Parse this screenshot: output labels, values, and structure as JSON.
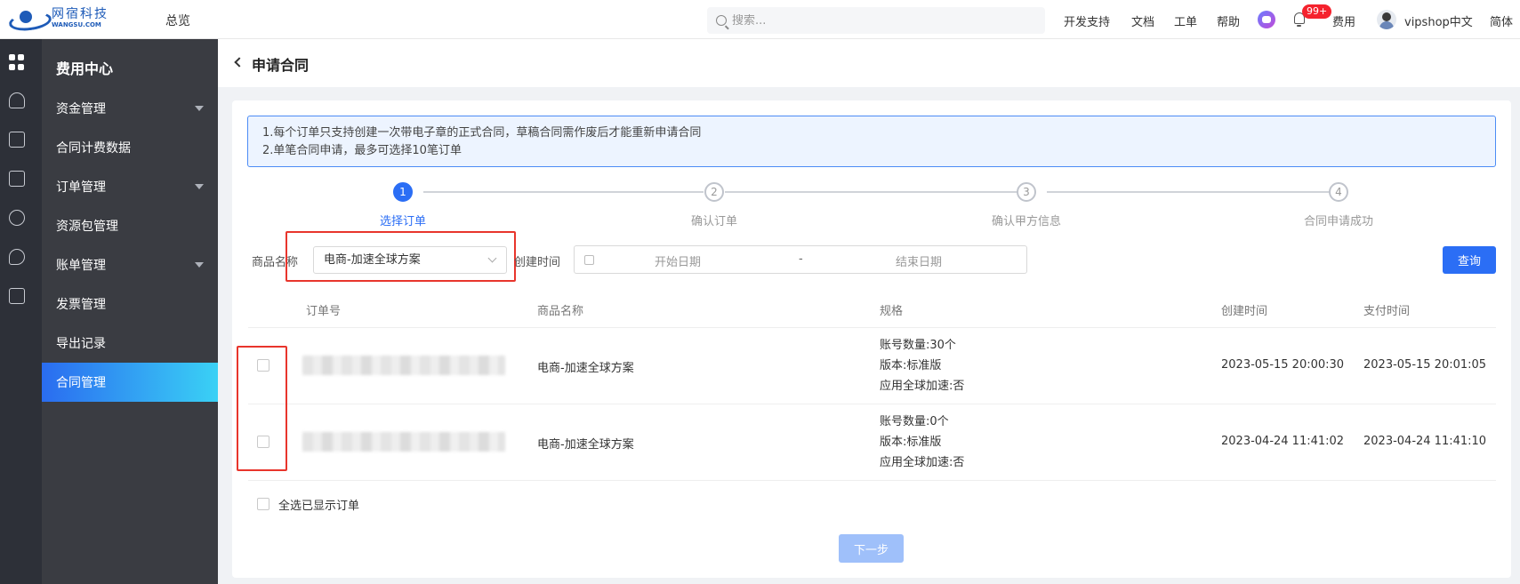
{
  "header": {
    "logo_cn": "网宿科技",
    "logo_en": "WANGSU.COM",
    "nav_overview": "总览",
    "search_placeholder": "搜索...",
    "links": [
      "开发支持",
      "文档",
      "工单",
      "帮助"
    ],
    "notification_badge": "99+",
    "fees_link": "费用",
    "username": "vipshop中文",
    "language": "简体"
  },
  "rail": {
    "icons": [
      "apps-grid-icon",
      "cloud-icon",
      "document-icon",
      "list-icon",
      "cluster-icon",
      "cloud-shield-icon",
      "monitor-icon"
    ]
  },
  "sidebar": {
    "title": "费用中心",
    "items": [
      {
        "label": "资金管理",
        "has_submenu": true
      },
      {
        "label": "合同计费数据",
        "has_submenu": false
      },
      {
        "label": "订单管理",
        "has_submenu": true
      },
      {
        "label": "资源包管理",
        "has_submenu": false
      },
      {
        "label": "账单管理",
        "has_submenu": true
      },
      {
        "label": "发票管理",
        "has_submenu": false
      },
      {
        "label": "导出记录",
        "has_submenu": false
      },
      {
        "label": "合同管理",
        "has_submenu": false,
        "active": true
      }
    ]
  },
  "page": {
    "title": "申请合同",
    "notice": [
      "1.每个订单只支持创建一次带电子章的正式合同，草稿合同需作废后才能重新申请合同",
      "2.单笔合同申请，最多可选择10笔订单"
    ],
    "steps": [
      {
        "num": "1",
        "label": "选择订单",
        "active": true
      },
      {
        "num": "2",
        "label": "确认订单",
        "active": false
      },
      {
        "num": "3",
        "label": "确认甲方信息",
        "active": false
      },
      {
        "num": "4",
        "label": "合同申请成功",
        "active": false
      }
    ],
    "filters": {
      "product_label": "商品名称",
      "product_value": "电商-加速全球方案",
      "created_label": "创建时间",
      "start_placeholder": "开始日期",
      "separator": "-",
      "end_placeholder": "结束日期",
      "query_button": "查询"
    },
    "table": {
      "columns": [
        "订单号",
        "商品名称",
        "规格",
        "创建时间",
        "支付时间"
      ],
      "rows": [
        {
          "product": "电商-加速全球方案",
          "spec": [
            "账号数量:30个",
            "版本:标准版",
            "应用全球加速:否"
          ],
          "created": "2023-05-15 20:00:30",
          "paid": "2023-05-15 20:01:05"
        },
        {
          "product": "电商-加速全球方案",
          "spec": [
            "账号数量:0个",
            "版本:标准版",
            "应用全球加速:否"
          ],
          "created": "2023-04-24 11:41:02",
          "paid": "2023-04-24 11:41:10"
        }
      ]
    },
    "select_all_label": "全选已显示订单",
    "next_button": "下一步"
  },
  "colors": {
    "primary": "#2b6ef5",
    "highlight": "#e8352c",
    "sidebar_bg": "#3a3c42",
    "rail_bg": "#2d3038"
  }
}
